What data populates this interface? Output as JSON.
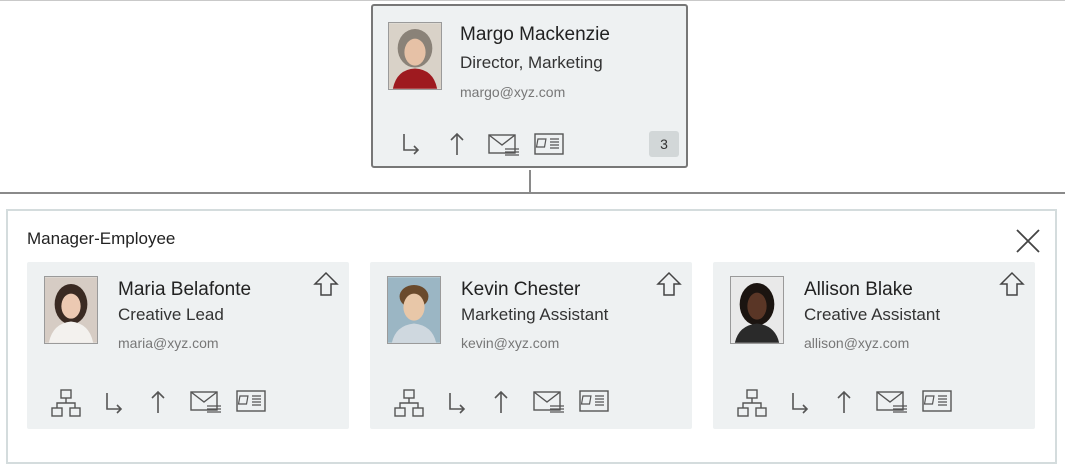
{
  "root": {
    "name": "Margo Mackenzie",
    "title": "Director, Marketing",
    "email": "margo@xyz.com",
    "reports_count": "3",
    "icons": [
      "direct-reports-icon",
      "go-up-icon",
      "email-icon",
      "contact-card-icon"
    ]
  },
  "panel": {
    "title": "Manager-Employee",
    "close_icon": "close-icon"
  },
  "employees": [
    {
      "name": "Maria Belafonte",
      "title": "Creative Lead",
      "email": "maria@xyz.com"
    },
    {
      "name": "Kevin Chester",
      "title": "Marketing Assistant",
      "email": "kevin@xyz.com"
    },
    {
      "name": "Allison Blake",
      "title": "Creative Assistant",
      "email": "allison@xyz.com"
    }
  ],
  "colors": {
    "card_bg": "#eef1f2",
    "card_border": "#777777",
    "badge_bg": "#d2d7d8",
    "icon": "#555555"
  }
}
